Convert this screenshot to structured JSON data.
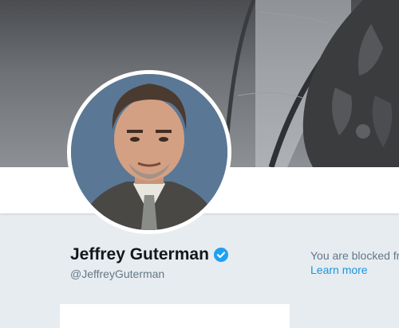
{
  "profile": {
    "name": "Jeffrey Guterman",
    "handle": "@JeffreyGuterman",
    "verified": true
  },
  "notice": {
    "blocked_text": "You are blocked fr",
    "learn_more_label": "Learn more"
  },
  "icons": {
    "verified": "verified-badge-icon"
  },
  "colors": {
    "link": "#1b95e0",
    "verified_badge": "#1da1f2",
    "page_background": "#e6ecf0",
    "name_text": "#14171a",
    "secondary_text": "#657786"
  }
}
